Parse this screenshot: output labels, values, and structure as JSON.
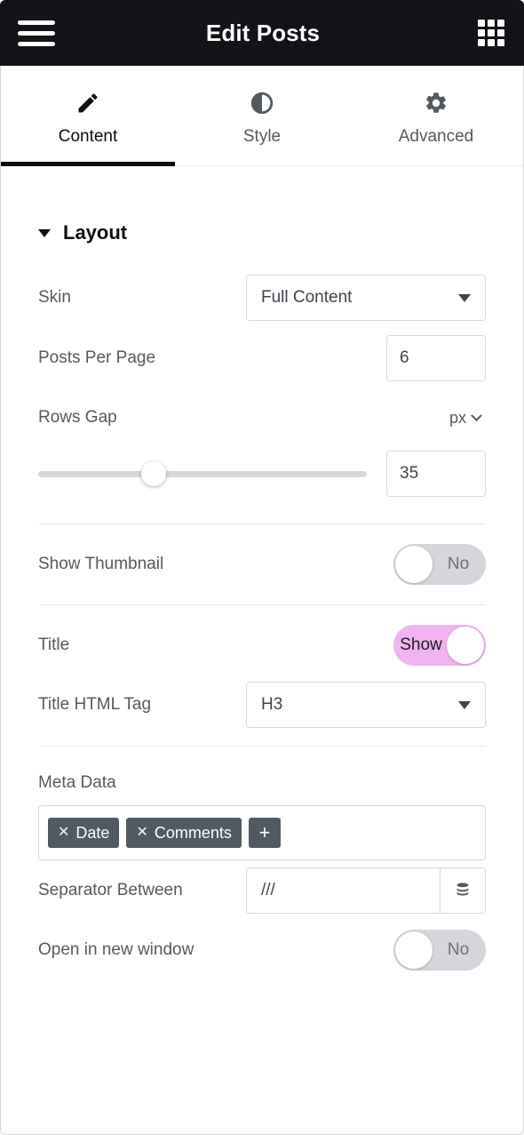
{
  "topbar": {
    "menu_icon": "hamburger-menu-icon",
    "title": "Edit Posts",
    "apps_icon": "apps-grid-icon"
  },
  "tabs": [
    {
      "label": "Content",
      "icon": "pencil-icon",
      "active": true
    },
    {
      "label": "Style",
      "icon": "contrast-icon",
      "active": false
    },
    {
      "label": "Advanced",
      "icon": "gear-icon",
      "active": false
    }
  ],
  "section": {
    "title": "Layout",
    "caret_icon": "caret-down-icon"
  },
  "controls": {
    "skin": {
      "label": "Skin",
      "value": "Full Content",
      "arrow_icon": "dropdown-arrow-icon"
    },
    "posts_per_page": {
      "label": "Posts Per Page",
      "value": "6"
    },
    "rows_gap": {
      "label": "Rows Gap",
      "unit": "px",
      "unit_chevron_icon": "chevron-down-icon",
      "value": "35",
      "slider_percent": 35
    },
    "show_thumbnail": {
      "label": "Show Thumbnail",
      "state": "No",
      "on": false
    },
    "title_toggle": {
      "label": "Title",
      "state": "Show",
      "on": true
    },
    "title_html_tag": {
      "label": "Title HTML Tag",
      "value": "H3",
      "arrow_icon": "dropdown-arrow-icon"
    },
    "meta_data": {
      "label": "Meta Data",
      "tags": [
        {
          "remove_icon": "remove-x-icon",
          "label": "Date"
        },
        {
          "remove_icon": "remove-x-icon",
          "label": "Comments"
        }
      ],
      "add_label": "+"
    },
    "separator_between": {
      "label": "Separator Between",
      "value": "///",
      "placeholder": "",
      "dynamic_icon": "database-stack-icon"
    },
    "open_new_window": {
      "label": "Open in new window",
      "state": "No",
      "on": false
    }
  },
  "colors": {
    "topbar_bg": "#121317",
    "accent_on": "#f0b4f0",
    "toggle_off": "#d4d6dc",
    "tag_bg": "#515962",
    "label_text": "#54595f",
    "border": "#d5d8dc"
  }
}
